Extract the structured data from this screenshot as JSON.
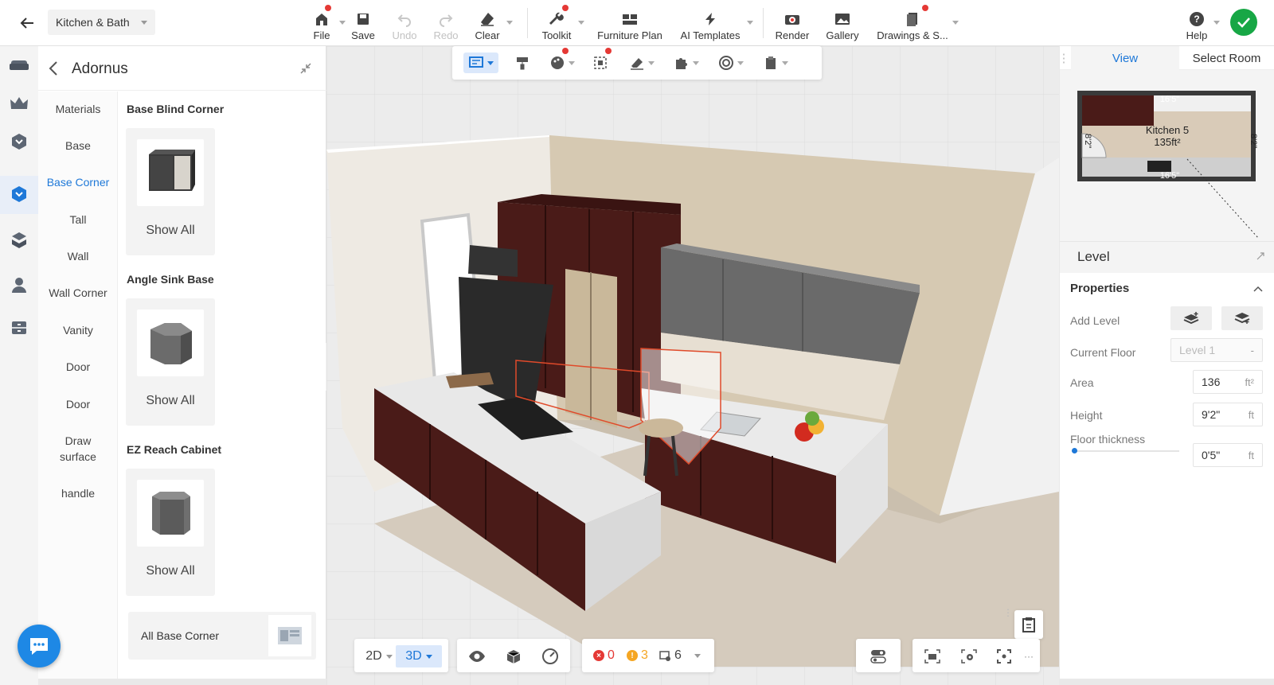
{
  "header": {
    "project_name": "Kitchen & Bath",
    "tools": [
      {
        "label": "File",
        "icon": "home-file-icon"
      },
      {
        "label": "Save",
        "icon": "save-icon"
      },
      {
        "label": "Undo",
        "icon": "undo-icon"
      },
      {
        "label": "Redo",
        "icon": "redo-icon"
      },
      {
        "label": "Clear",
        "icon": "eraser-icon"
      },
      {
        "label": "Toolkit",
        "icon": "wrench-icon"
      },
      {
        "label": "Furniture Plan",
        "icon": "furniture-plan-icon"
      },
      {
        "label": "AI Templates",
        "icon": "lightning-icon"
      },
      {
        "label": "Render",
        "icon": "camera-icon"
      },
      {
        "label": "Gallery",
        "icon": "gallery-icon"
      },
      {
        "label": "Drawings & S...",
        "icon": "drawings-icon"
      },
      {
        "label": "Help",
        "icon": "help-icon"
      }
    ]
  },
  "catalog": {
    "title": "Adornus",
    "categories": [
      "Materials",
      "Base",
      "Base Corner",
      "Tall",
      "Wall",
      "Wall Corner",
      "Vanity",
      "Door",
      "Door",
      "Draw surface",
      "handle"
    ],
    "active_category": "Base Corner",
    "products": [
      {
        "title": "Base Blind Corner",
        "action": "Show All"
      },
      {
        "title": "Angle Sink Base",
        "action": "Show All"
      },
      {
        "title": "EZ Reach Cabinet",
        "action": "Show All"
      }
    ],
    "all_label": "All Base Corner"
  },
  "right_panel": {
    "tabs": [
      "View",
      "Select Room"
    ],
    "active_tab": "View",
    "minimap": {
      "room_name": "Kitchen 5",
      "room_area": "135ft²",
      "dim_top": "16'5\"",
      "dim_bottom": "16'5\"",
      "dim_left": "8'2\"",
      "dim_right": "8'2\""
    },
    "level_title": "Level",
    "properties_title": "Properties",
    "add_level_label": "Add Level",
    "current_floor_label": "Current Floor",
    "current_floor_value": "Level 1",
    "area_label": "Area",
    "area_value": "136",
    "area_unit": "ft²",
    "height_label": "Height",
    "height_value": "9'2\"",
    "height_unit": "ft",
    "floor_thickness_label": "Floor thickness",
    "floor_thickness_value": "0'5\"",
    "floor_thickness_unit": "ft",
    "floor_thickness_slider_level": 0
  },
  "bottom": {
    "view_2d": "2D",
    "view_3d": "3D",
    "errors": "0",
    "warnings": "3",
    "items": "6",
    "more": "···"
  },
  "colors": {
    "accent": "#1e78d8",
    "ok_green": "#17a745",
    "error_red": "#e53935",
    "warning_orange": "#f5a623",
    "cabinet": "#4a1b18",
    "wall": "#d7cab3",
    "floor": "#d9cebf"
  }
}
